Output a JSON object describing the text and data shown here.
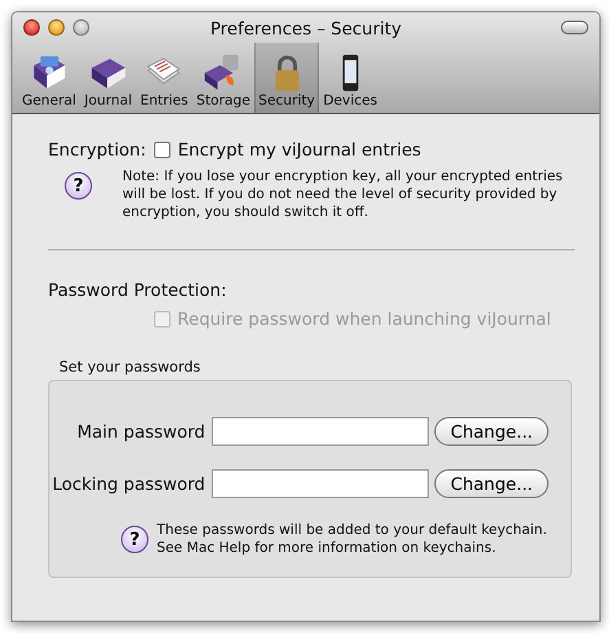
{
  "window": {
    "title": "Preferences – Security"
  },
  "toolbar": [
    {
      "label": "General",
      "kind": "general",
      "selected": false
    },
    {
      "label": "Journal",
      "kind": "journal",
      "selected": false
    },
    {
      "label": "Entries",
      "kind": "entries",
      "selected": false
    },
    {
      "label": "Storage",
      "kind": "storage",
      "selected": false
    },
    {
      "label": "Security",
      "kind": "security",
      "selected": true
    },
    {
      "label": "Devices",
      "kind": "devices",
      "selected": false
    }
  ],
  "encryption": {
    "label": "Encryption:",
    "checkbox": {
      "label": "Encrypt my viJournal entries",
      "checked": false,
      "disabled": false
    },
    "help": "?",
    "note": "Note: If you lose your encryption key, all your encrypted entries will be lost. If you do not need the level of security provided by encryption, you should switch it off."
  },
  "password_protection": {
    "label": "Password Protection:",
    "checkbox": {
      "label": "Require password when launching viJournal",
      "checked": false,
      "disabled": true
    }
  },
  "passwords_group": {
    "title": "Set your passwords",
    "rows": [
      {
        "label": "Main password",
        "button": "Change..."
      },
      {
        "label": "Locking password",
        "button": "Change..."
      }
    ],
    "help": "?",
    "note": "These passwords will be added to your default keychain.\nSee Mac Help for more information on keychains."
  }
}
